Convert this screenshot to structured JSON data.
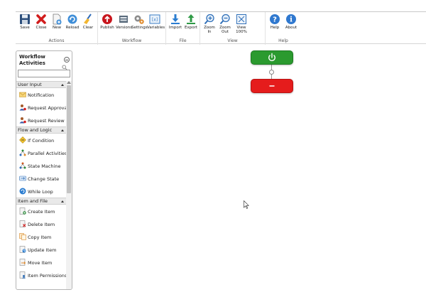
{
  "ribbon": {
    "groups": [
      {
        "name": "Actions",
        "buttons": [
          {
            "label": "Save",
            "icon": "floppy-disk-icon"
          },
          {
            "label": "Close",
            "icon": "red-x-icon"
          },
          {
            "label": "New",
            "icon": "new-document-icon"
          },
          {
            "label": "Reload",
            "icon": "reload-icon"
          },
          {
            "label": "Clear",
            "icon": "broom-icon"
          }
        ]
      },
      {
        "name": "Workflow",
        "buttons": [
          {
            "label": "Publish",
            "icon": "publish-icon"
          },
          {
            "label": "Versions",
            "icon": "versions-icon"
          },
          {
            "label": "Settings",
            "icon": "settings-icon"
          },
          {
            "label": "Variables",
            "icon": "variables-icon"
          }
        ]
      },
      {
        "name": "File",
        "buttons": [
          {
            "label": "Import",
            "icon": "import-icon"
          },
          {
            "label": "Export",
            "icon": "export-icon"
          }
        ]
      },
      {
        "name": "View",
        "buttons": [
          {
            "label": "Zoom In",
            "icon": "zoom-in-icon"
          },
          {
            "label": "Zoom Out",
            "icon": "zoom-out-icon"
          },
          {
            "label": "View 100%",
            "icon": "view-100-icon"
          }
        ]
      },
      {
        "name": "Help",
        "buttons": [
          {
            "label": "Help",
            "icon": "help-icon"
          },
          {
            "label": "About",
            "icon": "about-icon"
          }
        ]
      }
    ]
  },
  "sidebar": {
    "title": "Workflow Activities",
    "search_placeholder": "",
    "categories": [
      {
        "name": "User Input",
        "items": [
          "Notification",
          "Request Approval",
          "Request Review"
        ]
      },
      {
        "name": "Flow and Logic",
        "items": [
          "If Condition",
          "Parallel Activities",
          "State Machine",
          "Change State",
          "While Loop"
        ]
      },
      {
        "name": "Item and File",
        "items": [
          "Create Item",
          "Delete Item",
          "Copy Item",
          "Update Item",
          "Move Item",
          "Item Permissions"
        ]
      }
    ]
  },
  "canvas": {
    "start_icon": "power-icon",
    "end_icon": "minus-icon"
  },
  "colors": {
    "start": "#2b9a2f",
    "end": "#e51c1c"
  }
}
